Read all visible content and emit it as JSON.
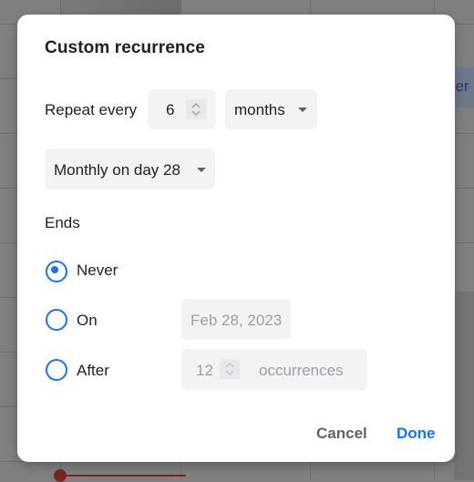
{
  "background": {
    "event_chip_text": "der"
  },
  "dialog": {
    "title": "Custom recurrence",
    "repeat": {
      "label": "Repeat every",
      "interval_value": "6",
      "unit_selected": "months"
    },
    "monthly_option": {
      "selected": "Monthly on day 28"
    },
    "ends": {
      "label": "Ends",
      "options": [
        {
          "label": "Never",
          "checked": true
        },
        {
          "label": "On",
          "checked": false
        },
        {
          "label": "After",
          "checked": false
        }
      ],
      "on_date": "Feb 28, 2023",
      "after_count": "12",
      "after_suffix": "occurrences"
    },
    "actions": {
      "cancel_label": "Cancel",
      "done_label": "Done"
    }
  },
  "colors": {
    "accent": "#1a73e8",
    "field_bg": "#f1f3f4",
    "disabled_text": "#9aa0a6",
    "scrim": "#808080"
  }
}
